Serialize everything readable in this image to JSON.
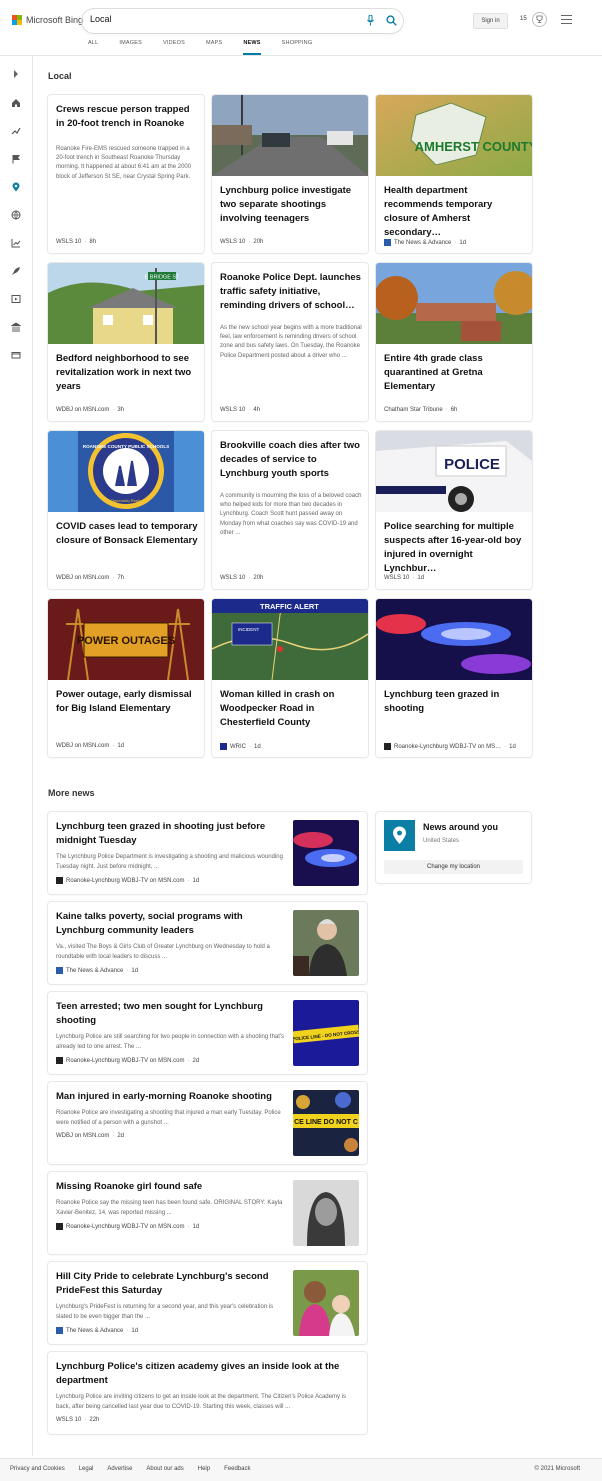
{
  "brand": "Microsoft Bing",
  "search": {
    "value": "Local"
  },
  "header": {
    "signin": "Sign in",
    "rewards_count": "15"
  },
  "tabs": [
    "ALL",
    "IMAGES",
    "VIDEOS",
    "MAPS",
    "NEWS",
    "SHOPPING"
  ],
  "active_tab": "NEWS",
  "local": {
    "title": "Local",
    "cards": [
      {
        "title": "Crews rescue person trapped in 20-foot trench in Roanoke",
        "snippet": "Roanoke Fire-EMS rescued someone trapped in a 20-foot trench in Southeast Roanoke Thursday morning. It happened at about 6:41 am at the 2000 block of Jefferson St SE, near Crystal Spring Park.",
        "source": "WSLS 10",
        "age": "8h"
      },
      {
        "title": "Lynchburg police investigate two separate shootings involving teenagers",
        "source": "WSLS 10",
        "age": "20h"
      },
      {
        "title": "Health department recommends temporary closure of Amherst secondary…",
        "source": "The News & Advance",
        "age": "1d",
        "image_text": "AMHERST COUNTY"
      },
      {
        "title": "Bedford neighborhood to see revitalization work in next two years",
        "source": "WDBJ on MSN.com",
        "age": "3h",
        "image_text": "E BRIDGE ST"
      },
      {
        "title": "Roanoke Police Dept. launches traffic safety initiative, reminding drivers of school…",
        "snippet": "As the new school year begins with a more traditional feel, law enforcement is reminding drivers of school zone and bus safety laws. On Tuesday, the Roanoke Police Department posted about a driver who ...",
        "source": "WSLS 10",
        "age": "4h"
      },
      {
        "title": "Entire 4th grade class quarantined at Gretna Elementary",
        "source": "Chatham Star Tribune",
        "age": "6h"
      },
      {
        "title": "COVID cases lead to temporary closure of Bonsack Elementary",
        "source": "WDBJ on MSN.com",
        "age": "7h",
        "image_text": "ROANOKE COUNTY PUBLIC SCHOOLS",
        "image_subtext": "Opportunity Ready"
      },
      {
        "title": "Brookville coach dies after two decades of service to Lynchburg youth sports",
        "snippet": "A community is mourning the loss of a beloved coach who helped kids for more than two decades in Lynchburg. Coach Scott hunt passed away on Monday from what coaches say was COVID-19 and other ...",
        "source": "WSLS 10",
        "age": "20h"
      },
      {
        "title": "Police searching for multiple suspects after 16-year-old boy injured in overnight Lynchbur…",
        "source": "WSLS 10",
        "age": "1d",
        "image_text": "POLICE"
      },
      {
        "title": "Power outage, early dismissal for Big Island Elementary",
        "source": "WDBJ on MSN.com",
        "age": "1d",
        "image_text": "POWER OUTAGES"
      },
      {
        "title": "Woman killed in crash on Woodpecker Road in Chesterfield County",
        "source": "WRIC",
        "age": "1d",
        "image_text": "TRAFFIC ALERT",
        "image_subtext": "INCIDENT"
      },
      {
        "title": "Lynchburg teen grazed in shooting",
        "source": "Roanoke-Lynchburg WDBJ-TV on MS…",
        "age": "1d"
      }
    ]
  },
  "more_news": {
    "title": "More news",
    "items": [
      {
        "title": "Lynchburg teen grazed in shooting just before midnight Tuesday",
        "snippet": "The Lynchburg Police Department is investigating a shooting and malicious wounding Tuesday night. Just before midnight, ...",
        "source": "Roanoke-Lynchburg WDBJ-TV on MSN.com",
        "age": "1d"
      },
      {
        "title": "Kaine talks poverty, social programs with Lynchburg community leaders",
        "snippet": "Va., visited The Boys & Girls Club of Greater Lynchburg on Wednesday to hold a roundtable with local leaders to discuss ...",
        "source": "The News & Advance",
        "age": "1d"
      },
      {
        "title": "Teen arrested; two men sought for Lynchburg shooting",
        "snippet": "Lynchburg Police are still searching for two people in connection with a shooting that's already led to one arrest. The ...",
        "source": "Roanoke-Lynchburg WDBJ-TV on MSN.com",
        "age": "2d",
        "image_text": "POLICE LINE - DO NOT CROSS"
      },
      {
        "title": "Man injured in early-morning Roanoke shooting",
        "snippet": "Roanoke Police are investigating a shooting that injured a man early Tuesday. Police were notified of a person with a gunshot ...",
        "source": "WDBJ on MSN.com",
        "age": "2d",
        "image_text": "CE LINE DO NOT C"
      },
      {
        "title": "Missing Roanoke girl found safe",
        "snippet": "Roanoke Police say the missing teen has been found safe. ORIGINAL STORY: Kayla Xavier-Benitez, 14, was reported missing ...",
        "source": "Roanoke-Lynchburg WDBJ-TV on MSN.com",
        "age": "1d"
      },
      {
        "title": "Hill City Pride to celebrate Lynchburg's second PrideFest this Saturday",
        "snippet": "Lynchburg's PrideFest is returning for a second year, and this year's celebration is slated to be even bigger than the ...",
        "source": "The News & Advance",
        "age": "1d"
      },
      {
        "title": "Lynchburg Police's citizen academy gives an inside look at the department",
        "snippet": "Lynchburg Police are inviting citizens to get an inside look at the department. The Citizen's Police Academy is back, after being cancelled last year due to COVID-19. Starting this week, classes will ...",
        "source": "WSLS 10",
        "age": "22h"
      }
    ]
  },
  "news_around": {
    "title": "News around you",
    "location": "United States",
    "button": "Change my location"
  },
  "footer": {
    "links": [
      "Privacy and Cookies",
      "Legal",
      "Advertise",
      "About our ads",
      "Help",
      "Feedback"
    ],
    "copyright": "© 2021 Microsoft"
  },
  "colors": {
    "accent": "#0a7ea4",
    "active_tab_underline": "#007daa"
  }
}
